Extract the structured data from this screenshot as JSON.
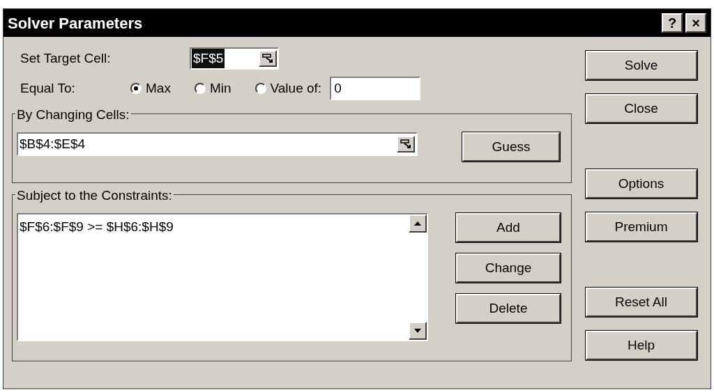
{
  "window": {
    "title": "Solver Parameters",
    "title_buttons": [
      "?",
      "×"
    ]
  },
  "target_cell": {
    "label": "Set Target Cell:",
    "value": "$F$5"
  },
  "equal_to": {
    "label": "Equal To:",
    "options": [
      {
        "label": "Max",
        "selected": true
      },
      {
        "label": "Min",
        "selected": false
      },
      {
        "label": "Value of:",
        "selected": false
      }
    ],
    "value": "0"
  },
  "changing_cells": {
    "label": "By Changing Cells:",
    "value": "$B$4:$E$4",
    "button": "Guess"
  },
  "constraints": {
    "label": "Subject to the Constraints:",
    "items": [
      "$F$6:$F$9 >= $H$6:$H$9"
    ],
    "buttons": [
      "Add",
      "Change",
      "Delete"
    ]
  },
  "side_button_groups": [
    [
      "Solve",
      "Close"
    ],
    [
      "Options",
      "Premium"
    ],
    [
      "Reset All",
      "Help"
    ]
  ]
}
